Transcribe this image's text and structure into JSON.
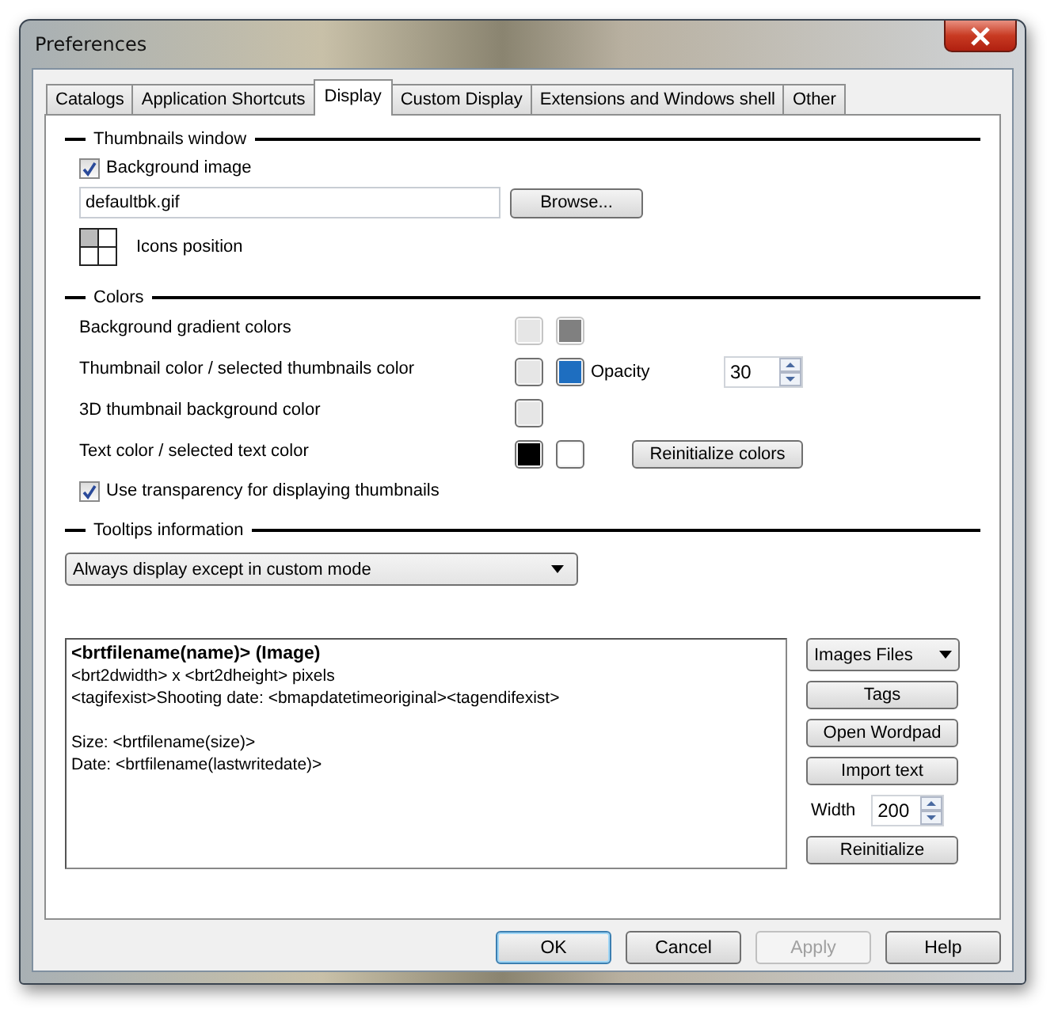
{
  "window": {
    "title": "Preferences"
  },
  "tabs": [
    {
      "label": "Catalogs",
      "selected": false
    },
    {
      "label": "Application Shortcuts",
      "selected": false
    },
    {
      "label": "Display",
      "selected": true
    },
    {
      "label": "Custom Display",
      "selected": false
    },
    {
      "label": "Extensions and Windows shell",
      "selected": false
    },
    {
      "label": "Other",
      "selected": false
    }
  ],
  "thumbnails_window": {
    "heading": "Thumbnails window",
    "background_image": {
      "label": "Background image",
      "checked": true
    },
    "file_field": {
      "value": "defaultbk.gif"
    },
    "browse_button": {
      "label": "Browse..."
    },
    "icons_position": {
      "label": "Icons position"
    }
  },
  "colors": {
    "heading": "Colors",
    "rows": [
      {
        "label": "Background gradient colors",
        "swatches": [
          {
            "color": "#e6e6e6",
            "disabled": true
          },
          {
            "color": "#808080",
            "disabled": true
          }
        ]
      },
      {
        "label": "Thumbnail color / selected thumbnails color",
        "swatches": [
          {
            "color": "#e6e6e6",
            "disabled": false
          },
          {
            "color": "#1e6ec0",
            "disabled": false
          }
        ],
        "extra": {
          "kind": "opacity",
          "label": "Opacity",
          "value": "30"
        }
      },
      {
        "label": "3D thumbnail background color",
        "swatches": [
          {
            "color": "#e6e6e6",
            "disabled": false
          }
        ]
      },
      {
        "label": "Text color / selected text color",
        "swatches": [
          {
            "color": "#000000",
            "disabled": false
          },
          {
            "color": "#ffffff",
            "disabled": false
          }
        ],
        "extra": {
          "kind": "button",
          "label": "Reinitialize colors"
        }
      }
    ],
    "transparency": {
      "label": "Use transparency for displaying thumbnails",
      "checked": true
    }
  },
  "tooltips": {
    "heading": "Tooltips information",
    "mode_select": {
      "value": "Always display except in custom mode"
    },
    "template_lines": [
      {
        "text": "<brtfilename(name)> (Image)",
        "bold": true,
        "blank_before": false
      },
      {
        "text": "<brt2dwidth> x <brt2dheight> pixels",
        "bold": false,
        "blank_before": false
      },
      {
        "text": "<tagifexist>Shooting date: <bmapdatetimeoriginal><tagendifexist>",
        "bold": false,
        "blank_before": false
      },
      {
        "text": "Size: <brtfilename(size)>",
        "bold": false,
        "blank_before": true
      },
      {
        "text": "Date: <brtfilename(lastwritedate)>",
        "bold": false,
        "blank_before": false
      }
    ],
    "type_select": {
      "value": "Images Files"
    },
    "side_buttons": [
      {
        "label": "Tags"
      },
      {
        "label": "Open Wordpad"
      },
      {
        "label": "Import text"
      }
    ],
    "width": {
      "label": "Width",
      "value": "200"
    },
    "reinitialize_button": {
      "label": "Reinitialize"
    }
  },
  "buttons": [
    {
      "label": "OK",
      "default": true,
      "disabled": false
    },
    {
      "label": "Cancel",
      "default": false,
      "disabled": false
    },
    {
      "label": "Apply",
      "default": false,
      "disabled": true
    },
    {
      "label": "Help",
      "default": false,
      "disabled": false
    }
  ]
}
